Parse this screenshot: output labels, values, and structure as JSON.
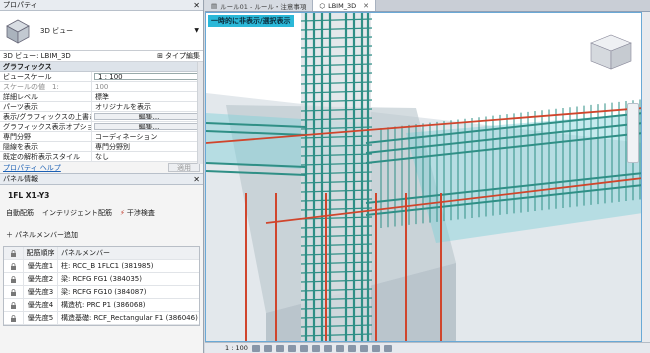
{
  "properties_panel": {
    "title": "プロパティ",
    "type_name": "3D ビュー",
    "instance": "3D ビュー: LBIM_3D",
    "edit_type": "タイプ編集",
    "group": "グラフィックス",
    "rows": [
      {
        "key": "ビュースケール",
        "value": "1 : 100",
        "style": "boxed"
      },
      {
        "key": "スケールの値　1:",
        "value": "100",
        "style": "disabled"
      },
      {
        "key": "詳細レベル",
        "value": "標準",
        "style": ""
      },
      {
        "key": "パーツ表示",
        "value": "オリジナルを表示",
        "style": ""
      },
      {
        "key": "表示/グラフィックスの上書き",
        "value": "編集...",
        "style": "btn"
      },
      {
        "key": "グラフィックス表示オプション",
        "value": "編集...",
        "style": "btn"
      },
      {
        "key": "専門分野",
        "value": "コーディネーション",
        "style": ""
      },
      {
        "key": "隠線を表示",
        "value": "専門分野別",
        "style": ""
      },
      {
        "key": "既定の解析表示スタイル",
        "value": "なし",
        "style": ""
      }
    ],
    "help_link": "プロパティ ヘルプ",
    "apply": "適用"
  },
  "panel_info": {
    "title": "パネル情報",
    "panel_name": "1FL X1-Y3",
    "auto_place": "自動配筋",
    "intelligent_place": "インテリジェント配筋",
    "clash_check": "干渉検査",
    "add_member": "パネルメンバー追加",
    "columns": [
      "配筋順序",
      "パネルメンバー"
    ],
    "rows": [
      {
        "order": "優先度1",
        "member": "柱: RCC_B 1FLC1 (381985)"
      },
      {
        "order": "優先度2",
        "member": "梁: RCFG FG1 (384035)"
      },
      {
        "order": "優先度3",
        "member": "梁: RCFG FG10 (384087)"
      },
      {
        "order": "優先度4",
        "member": "構造杭: PRC P1 (386068)"
      },
      {
        "order": "優先度5",
        "member": "構造基礎: RCF_Rectangular F1 (386046)"
      }
    ]
  },
  "tabs": [
    {
      "label": "ルール01 - ルール・注意事項",
      "active": false
    },
    {
      "label": "LBIM_3D",
      "active": true
    }
  ],
  "viewport": {
    "overlay": "一時的に非表示/選択表示"
  },
  "statusbar": {
    "scale": "1 : 100"
  },
  "colors": {
    "rebar_teal": "#2f8f86",
    "rebar_red": "#d0452c",
    "concrete": "#b8c4cc",
    "highlight": "#2bb8d8"
  }
}
